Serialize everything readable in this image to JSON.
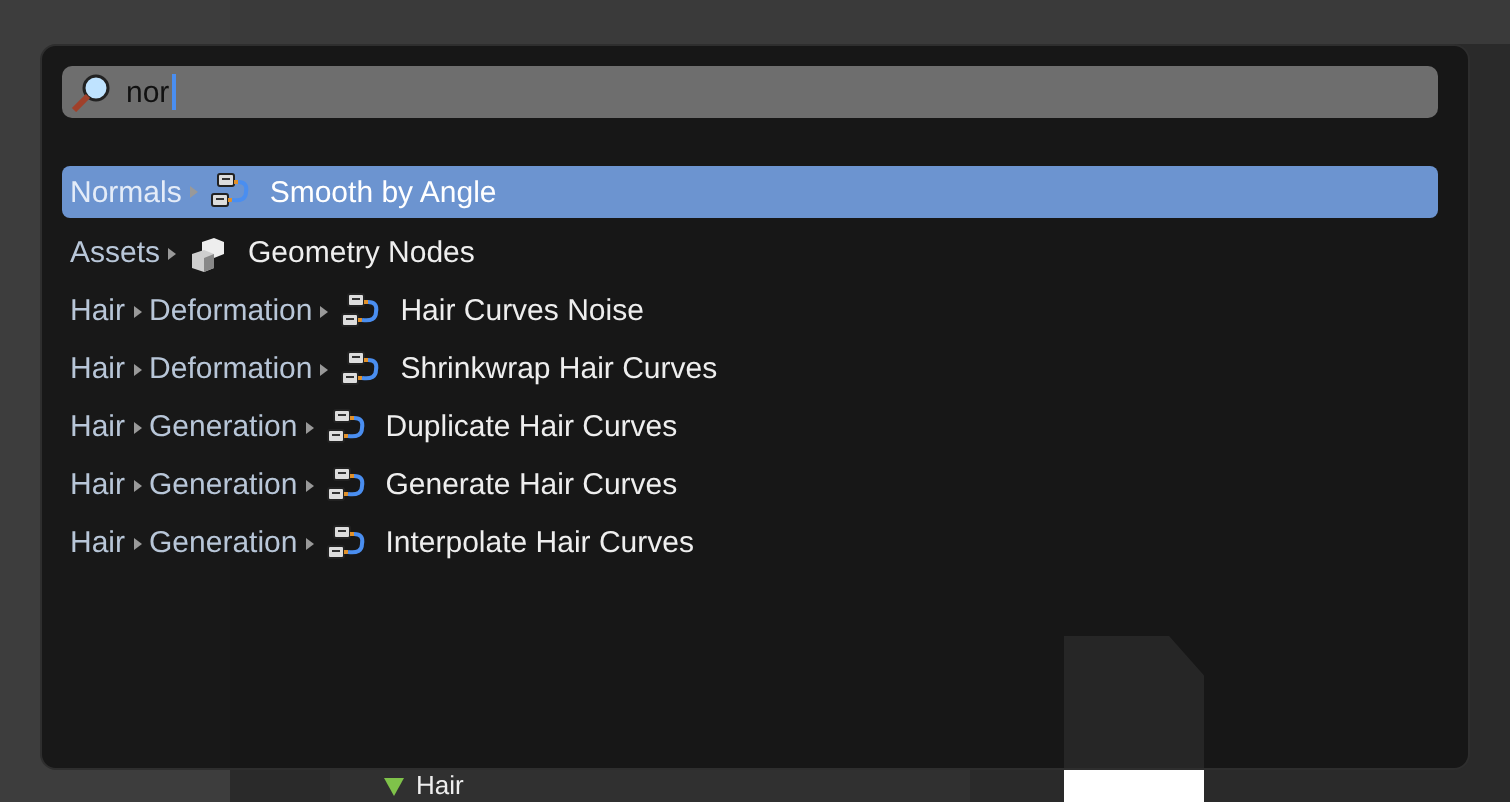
{
  "background": {
    "catalog_tree": [
      {
        "label": "Hair",
        "expanded": true
      }
    ]
  },
  "search": {
    "value": "nor"
  },
  "results": [
    {
      "path": [
        "Normals"
      ],
      "kind": "node_group",
      "name": "Smooth by Angle",
      "selected": true
    },
    {
      "path": [
        "Assets"
      ],
      "kind": "mesh",
      "name": "Geometry Nodes",
      "selected": false
    },
    {
      "path": [
        "Hair",
        "Deformation"
      ],
      "kind": "node_group",
      "name": "Hair Curves Noise",
      "selected": false
    },
    {
      "path": [
        "Hair",
        "Deformation"
      ],
      "kind": "node_group",
      "name": "Shrinkwrap Hair Curves",
      "selected": false
    },
    {
      "path": [
        "Hair",
        "Generation"
      ],
      "kind": "node_group",
      "name": "Duplicate Hair Curves",
      "selected": false
    },
    {
      "path": [
        "Hair",
        "Generation"
      ],
      "kind": "node_group",
      "name": "Generate Hair Curves",
      "selected": false
    },
    {
      "path": [
        "Hair",
        "Generation"
      ],
      "kind": "node_group",
      "name": "Interpolate Hair Curves",
      "selected": false
    }
  ]
}
